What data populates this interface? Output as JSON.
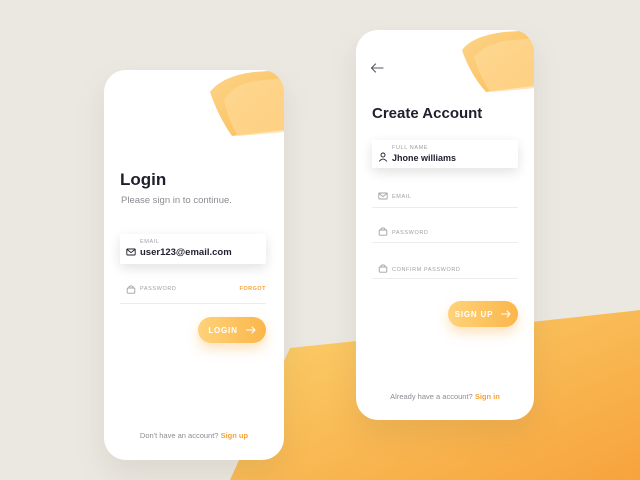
{
  "login": {
    "title": "Login",
    "subtitle": "Please sign in to continue.",
    "email": {
      "label": "EMAIL",
      "value": "user123@email.com"
    },
    "password": {
      "label": "PASSWORD",
      "forgot": "FORGOT"
    },
    "button_label": "LOGIN",
    "footer_text": "Don't have an account?",
    "footer_link": "Sign up"
  },
  "signup": {
    "title": "Create Account",
    "full_name": {
      "label": "FULL NAME",
      "value": "Jhone williams"
    },
    "email": {
      "label": "EMAIL"
    },
    "password": {
      "label": "PASSWORD"
    },
    "confirm_password": {
      "label": "CONFIRM PASSWORD"
    },
    "button_label": "SIGN UP",
    "footer_text": "Already have a account?",
    "footer_link": "Sign in"
  },
  "colors": {
    "background": "#ebe8e2",
    "accent": "#f5a23a",
    "accent_light": "#ffd27a",
    "text_dark": "#1f1f2e",
    "text_muted": "#8c8c92"
  }
}
